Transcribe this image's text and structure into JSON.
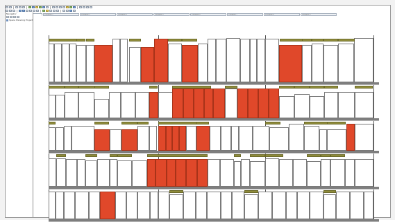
{
  "app": {
    "window_title": ""
  },
  "toolbar": {
    "row1": [
      "btn",
      "btn",
      "sep",
      "btn",
      "btn",
      "btn",
      "sep",
      "g",
      "b",
      "y",
      "g",
      "b",
      "btn",
      "sep",
      "btn",
      "btn",
      "btn",
      "btn",
      "y",
      "g",
      "b",
      "sep",
      "btn",
      "btn",
      "btn",
      "btn"
    ],
    "row2": [
      "btn",
      "btn",
      "btn",
      "sep",
      "b",
      "b",
      "btn",
      "btn",
      "btn",
      "btn",
      "sep",
      "g",
      "y",
      "btn",
      "btn",
      "btn",
      "sep",
      "btn",
      "btn",
      "b",
      "btn"
    ]
  },
  "tabs": [
    {
      "label": "Planogram 1",
      "active": true
    },
    {
      "label": "Planogram 2"
    },
    {
      "label": "Planogram 3"
    },
    {
      "label": "Planogram 4"
    },
    {
      "label": "Planogram 5"
    },
    {
      "label": "Planogram 6"
    },
    {
      "label": "Planogram 7"
    },
    {
      "label": "Planogram 8"
    },
    {
      "label": "Planogram 9"
    }
  ],
  "navigator": {
    "header": "Navigator",
    "tool_icons": [
      "new-icon",
      "open-icon",
      "filter-icon",
      "sort-icon"
    ],
    "item_label": "Space Planning Project"
  },
  "colors": {
    "highlight": "#e0482a",
    "overstock": "#8f8c3b",
    "shelf": "#7e7e7e",
    "facing": "#ffffff"
  },
  "fixture": {
    "bay_count": 4,
    "shelf_count": 5,
    "highlight_meaning": "selected products",
    "overstock_meaning": "overstock"
  }
}
